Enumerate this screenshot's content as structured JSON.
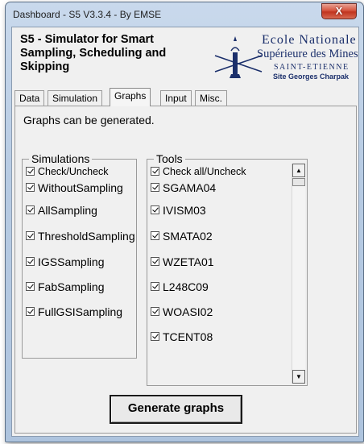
{
  "window": {
    "title": "Dashboard - S5 V3.3.4 - By EMSE",
    "close_label": "X"
  },
  "header": {
    "app_title": "S5 - Simulator for Smart Sampling, Scheduling and Skipping",
    "logo": {
      "line1": "Ecole Nationale",
      "line2": "Supérieure des Mines",
      "line3": "SAINT-ETIENNE",
      "line4": "Site Georges Charpak"
    }
  },
  "tabs": [
    {
      "label": "Data"
    },
    {
      "label": "Simulation"
    },
    {
      "label": "Graphs"
    },
    {
      "label": "Input"
    },
    {
      "label": "Misc."
    }
  ],
  "active_tab": "Graphs",
  "graphs": {
    "status": "Graphs can be generated.",
    "simulations": {
      "title": "Simulations",
      "items": [
        {
          "label": "Check/Uncheck",
          "checked": true
        },
        {
          "label": "WithoutSampling",
          "checked": true
        },
        {
          "label": "AllSampling",
          "checked": true
        },
        {
          "label": "ThresholdSampling",
          "checked": true
        },
        {
          "label": "IGSSampling",
          "checked": true
        },
        {
          "label": "FabSampling",
          "checked": true
        },
        {
          "label": "FullGSISampling",
          "checked": true
        }
      ]
    },
    "tools": {
      "title": "Tools",
      "items": [
        {
          "label": "Check all/Uncheck",
          "checked": true
        },
        {
          "label": "SGAMA04",
          "checked": true
        },
        {
          "label": "IVISM03",
          "checked": true
        },
        {
          "label": "SMATA02",
          "checked": true
        },
        {
          "label": "WZETA01",
          "checked": true
        },
        {
          "label": "L248C09",
          "checked": true
        },
        {
          "label": "WOASI02",
          "checked": true
        },
        {
          "label": "TCENT08",
          "checked": true
        }
      ]
    },
    "generate_label": "Generate graphs"
  },
  "colors": {
    "window_frame": "#b7cbe3",
    "close_button": "#d6553f",
    "logo_text": "#1b2f6b"
  }
}
